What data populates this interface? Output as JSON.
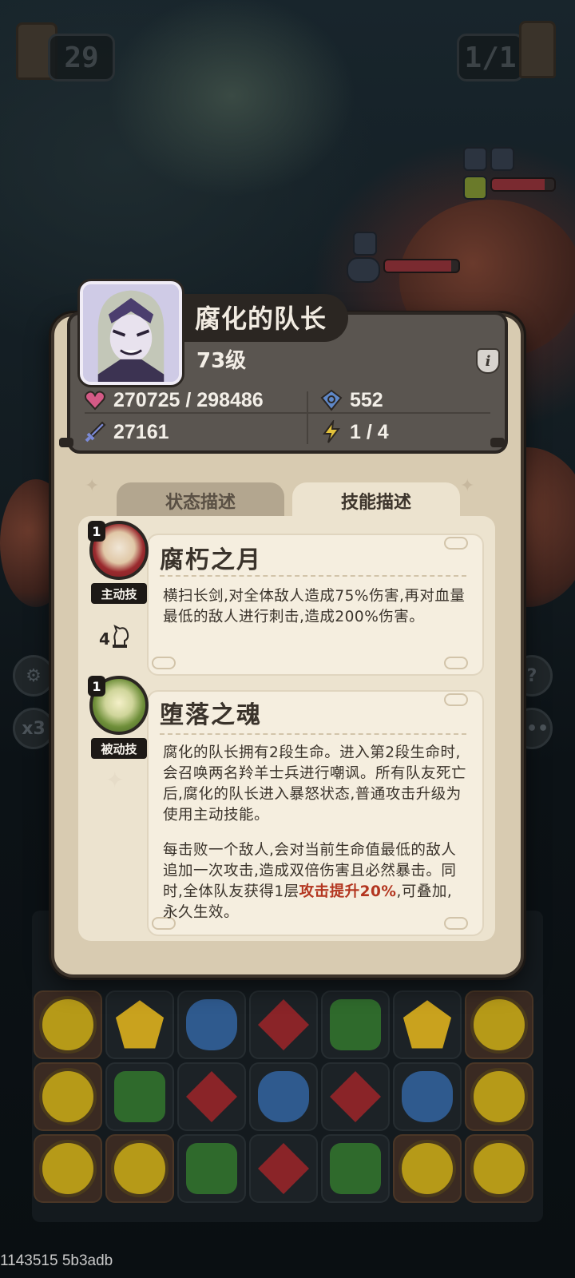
{
  "hud": {
    "moves_left": "29",
    "wave": "1/1",
    "speed": "x3"
  },
  "hero": {
    "name": "腐化的队长",
    "level": "73级",
    "info_label": "i",
    "stats": {
      "hp": "270725 / 298486",
      "defense": "552",
      "attack": "27161",
      "energy": "1 / 4"
    }
  },
  "tabs": [
    {
      "label": "状态描述",
      "active": false
    },
    {
      "label": "技能描述",
      "active": true
    }
  ],
  "skills": [
    {
      "level": "1",
      "type": "主动技",
      "name": "腐朽之月",
      "cost": "4",
      "description": "横扫长剑,对全体敌人造成75%伤害,再对血量最低的敌人进行刺击,造成200%伤害。"
    },
    {
      "level": "1",
      "type": "被动技",
      "name": "堕落之魂",
      "description": "腐化的队长拥有2段生命。进入第2段生命时,会召唤两名羚羊士兵进行嘲讽。所有队友死亡后,腐化的队长进入暴怒状态,普通攻击升级为使用主动技能。",
      "description2_before": "每击败一个敌人,会对当前生命值最低的敌人追加一次攻击,造成双倍伤害且必然暴击。同时,全体队友获得1层",
      "description2_highlight": "攻击提升20%",
      "description2_after": ",可叠加,永久生效。"
    }
  ],
  "board": {
    "rows": [
      [
        "face",
        "y",
        "b",
        "r",
        "g",
        "y",
        "face"
      ],
      [
        "face",
        "g",
        "r",
        "b",
        "r",
        "b",
        "face"
      ],
      [
        "face",
        "face",
        "g",
        "r",
        "g",
        "face",
        "face"
      ]
    ]
  },
  "colors": {
    "highlight": "#b3351f",
    "panel": "#5a5550",
    "parchment": "#d8cbb1",
    "active_badge": "#9a2a2e",
    "passive_badge": "#6f8f3a"
  },
  "build_tag": "1143515 5b3adb"
}
